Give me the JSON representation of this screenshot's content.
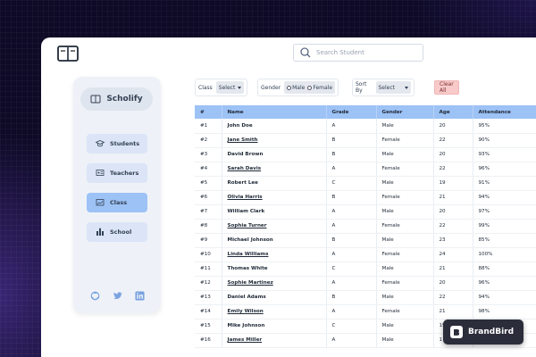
{
  "search": {
    "placeholder": "Search Student"
  },
  "sidebar": {
    "brand": "Scholify",
    "items": [
      {
        "label": "Students",
        "icon": "graduation-cap-icon",
        "active": false
      },
      {
        "label": "Teachers",
        "icon": "teacher-icon",
        "active": false
      },
      {
        "label": "Class",
        "icon": "classroom-icon",
        "active": true
      },
      {
        "label": "School",
        "icon": "school-icon",
        "active": false
      }
    ],
    "socials": [
      "github-icon",
      "twitter-icon",
      "linkedin-icon"
    ]
  },
  "filters": {
    "class_label": "Class",
    "class_value": "Select",
    "gender_label": "Gender",
    "gender_options": [
      "Male",
      "Female"
    ],
    "sort_label": "Sort By",
    "sort_value": "Select",
    "clear_label": "Clear All"
  },
  "table": {
    "columns": [
      "#",
      "Name",
      "Grade",
      "Gender",
      "Age",
      "Attendance"
    ],
    "rows": [
      [
        "#1",
        "John Doe",
        "A",
        "Male",
        "20",
        "95%"
      ],
      [
        "#2",
        "Jane Smith",
        "B",
        "Female",
        "22",
        "90%"
      ],
      [
        "#3",
        "David Brown",
        "B",
        "Male",
        "20",
        "93%"
      ],
      [
        "#4",
        "Sarah Davis",
        "A",
        "Female",
        "22",
        "96%"
      ],
      [
        "#5",
        "Robert Lee",
        "C",
        "Male",
        "19",
        "91%"
      ],
      [
        "#6",
        "Olivia Harris",
        "B",
        "Female",
        "21",
        "94%"
      ],
      [
        "#7",
        "William Clark",
        "A",
        "Male",
        "20",
        "97%"
      ],
      [
        "#8",
        "Sophia Turner",
        "A",
        "Female",
        "22",
        "99%"
      ],
      [
        "#9",
        "Michael Johnson",
        "B",
        "Male",
        "23",
        "85%"
      ],
      [
        "#10",
        "Linda Williams",
        "A",
        "Female",
        "24",
        "100%"
      ],
      [
        "#11",
        "Thomas White",
        "C",
        "Male",
        "21",
        "88%"
      ],
      [
        "#12",
        "Sophie Martinez",
        "A",
        "Female",
        "20",
        "96%"
      ],
      [
        "#13",
        "Daniel Adams",
        "B",
        "Male",
        "22",
        "94%"
      ],
      [
        "#14",
        "Emily Wilson",
        "A",
        "Female",
        "21",
        "98%"
      ],
      [
        "#15",
        "Mike Johnson",
        "C",
        "Male",
        "19",
        ""
      ],
      [
        "#16",
        "James Miller",
        "A",
        "Male",
        "1",
        ""
      ]
    ],
    "underlined": [
      1,
      3,
      5,
      7,
      9,
      11,
      13,
      15
    ]
  },
  "watermark": {
    "label": "BrandBird"
  },
  "colors": {
    "accent": "#9dc2f5",
    "clear": "#f8caca",
    "background": "#0e0a26"
  }
}
